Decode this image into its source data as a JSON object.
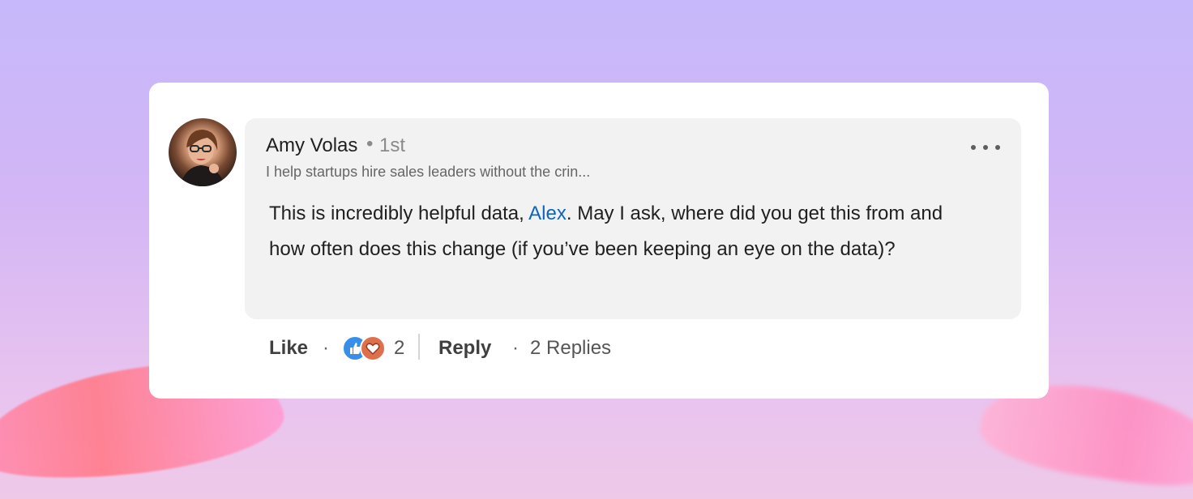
{
  "comment": {
    "author": {
      "name": "Amy Volas",
      "separator": "•",
      "connection_degree": "1st",
      "headline": "I help startups hire sales leaders without the crin..."
    },
    "body": {
      "prefix": "This is incredibly helpful data, ",
      "mention": "Alex",
      "suffix": ".  May I ask, where did you get this from and how often does this change (if you’ve been keeping an eye on the data)?"
    },
    "more_icon": "ellipsis-horizontal-icon",
    "colors": {
      "mention": "#0a66c2",
      "like_reaction": "#378fe9",
      "love_reaction": "#df704d"
    }
  },
  "actions": {
    "like_label": "Like",
    "separator": "·",
    "reaction_icons": [
      "thumbs-up-icon",
      "heart-icon"
    ],
    "reaction_count": "2",
    "reply_label": "Reply",
    "replies_label": "2 Replies"
  }
}
